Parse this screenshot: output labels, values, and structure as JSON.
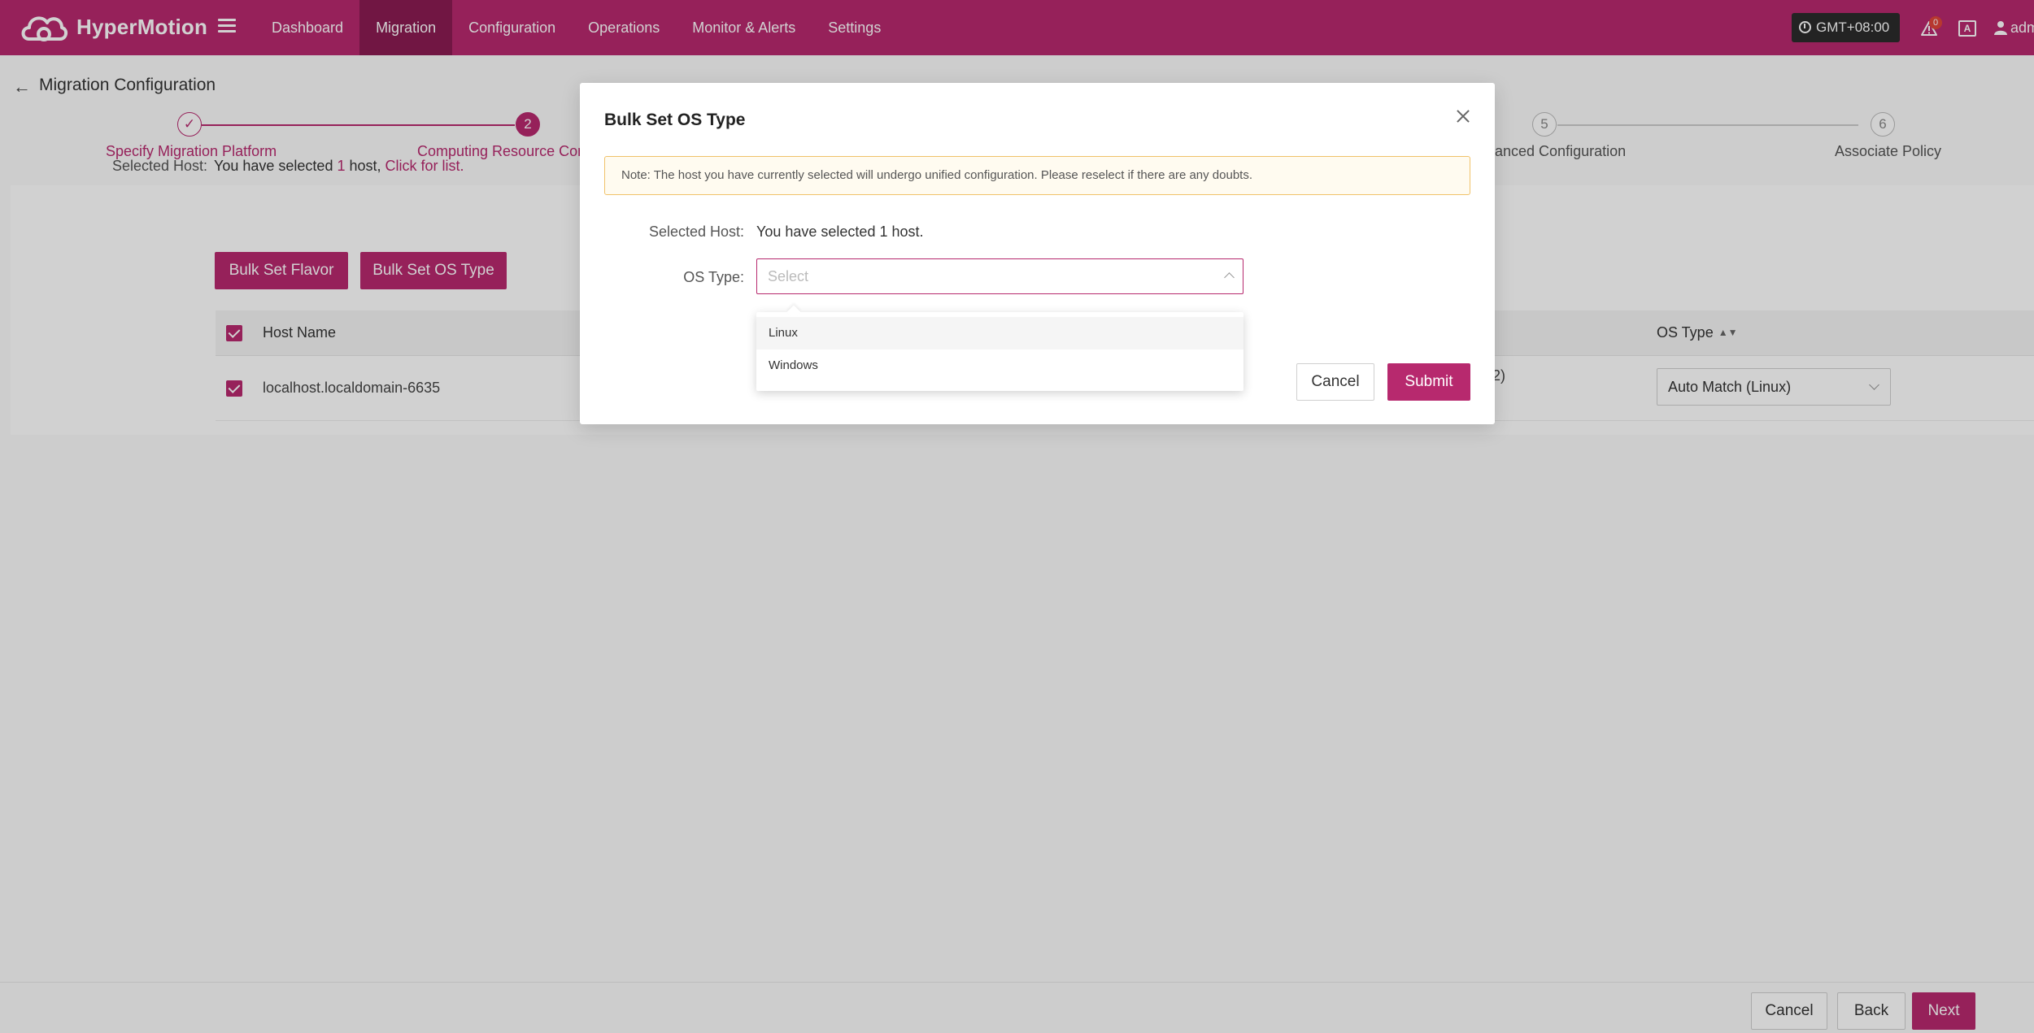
{
  "app": {
    "brand": "HyperMotion",
    "user": "adm",
    "timezone": "GMT+08:00",
    "alert_count": "0",
    "lang_icon_text": "A"
  },
  "nav": {
    "items": [
      {
        "label": "Dashboard",
        "active": false
      },
      {
        "label": "Migration",
        "active": true
      },
      {
        "label": "Configuration",
        "active": false
      },
      {
        "label": "Operations",
        "active": false
      },
      {
        "label": "Monitor & Alerts",
        "active": false
      },
      {
        "label": "Settings",
        "active": false
      }
    ]
  },
  "page": {
    "title": "Migration Configuration",
    "steps": [
      {
        "number": "✓",
        "label": "Specify Migration Platform",
        "state": "done"
      },
      {
        "number": "2",
        "label": "Computing Resource Configuration",
        "visible_label": "Computing Resource Cont",
        "state": "active"
      },
      {
        "number": "5",
        "label": "Advanced Configuration",
        "visible_label": "anced Configuration",
        "state": "future"
      },
      {
        "number": "6",
        "label": "Associate Policy",
        "state": "future"
      }
    ],
    "selected_host_label": "Selected Host:",
    "selected_prefix": "You have selected ",
    "selected_count": "1",
    "selected_suffix": " host, ",
    "selected_link": "Click for list.",
    "bulk_flavor_button": "Bulk Set Flavor",
    "bulk_os_button": "Bulk Set OS Type",
    "table": {
      "columns": [
        "Host Name",
        "OS Type"
      ],
      "rows": [
        {
          "host_name": "localhost.localdomain-6635",
          "partial_cell": "2)",
          "os_type": "Auto Match (Linux)"
        }
      ]
    }
  },
  "footer": {
    "cancel": "Cancel",
    "back": "Back",
    "next": "Next"
  },
  "modal": {
    "title": "Bulk Set OS Type",
    "note": "Note: The host you have currently selected will undergo unified configuration. Please reselect if there are any doubts.",
    "selected_host_label": "Selected Host:",
    "selected_host_text": "You have selected 1 host.",
    "os_type_label": "OS Type:",
    "os_type_placeholder": "Select",
    "options": [
      "Linux",
      "Windows"
    ],
    "cancel": "Cancel",
    "submit": "Submit"
  },
  "colors": {
    "accent": "#b7296e",
    "accent_dark": "#8a1c52",
    "warning_border": "#f0c26a"
  }
}
